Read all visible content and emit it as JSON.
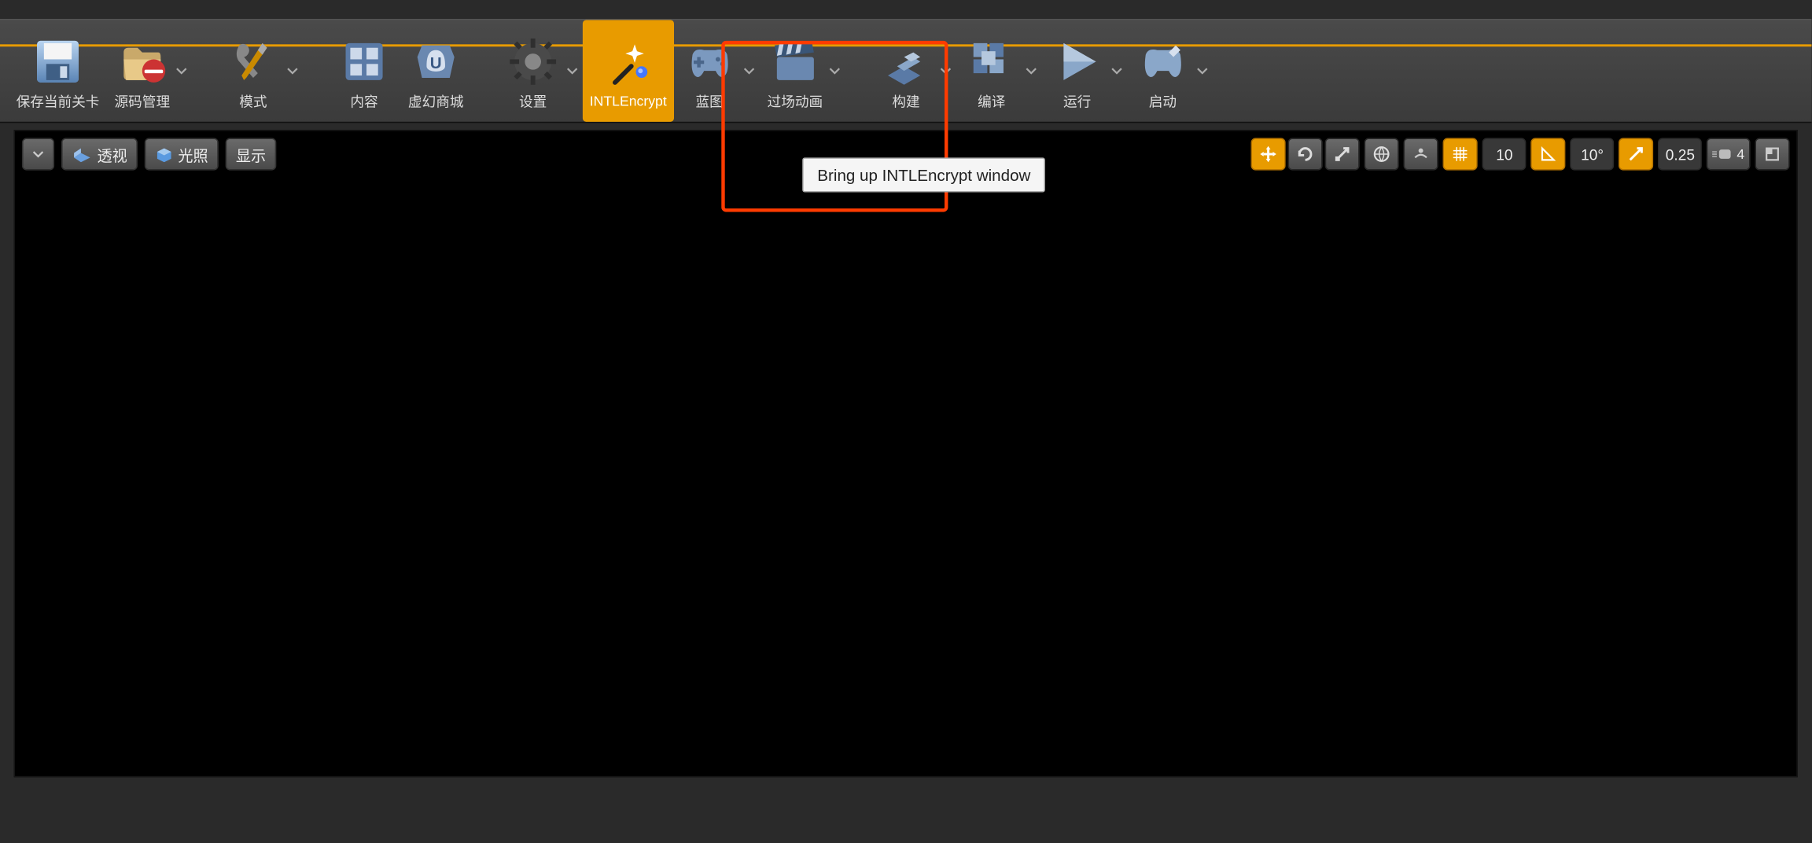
{
  "toolbar": {
    "save": "保存当前关卡",
    "sourceControl": "源码管理",
    "mode": "模式",
    "content": "内容",
    "marketplace": "虚幻商城",
    "settings": "设置",
    "intlencrypt": "INTLEncrypt",
    "blueprint": "蓝图",
    "cinematics": "过场动画",
    "build": "构建",
    "compile": "编译",
    "play": "运行",
    "launch": "启动"
  },
  "tooltip": "Bring up INTLEncrypt window",
  "viewport": {
    "perspective": "透视",
    "lighting": "光照",
    "show": "显示",
    "grid_snap": "10",
    "angle_snap": "10°",
    "scale_snap": "0.25",
    "camera_speed": "4"
  }
}
